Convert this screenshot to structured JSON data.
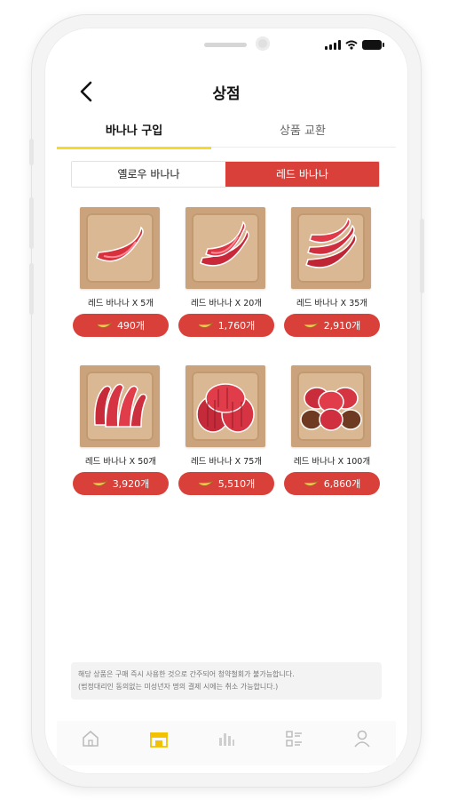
{
  "header": {
    "title": "상점"
  },
  "tabs": [
    {
      "label": "바나나 구입",
      "active": true
    },
    {
      "label": "상품 교환",
      "active": false
    }
  ],
  "segments": [
    {
      "label": "옐로우 바나나",
      "active": false
    },
    {
      "label": "레드 바나나",
      "active": true
    }
  ],
  "products": [
    {
      "name": "레드 바나나 X 5개",
      "price": "490개",
      "icon": "banana-single-icon"
    },
    {
      "name": "레드 바나나 X 20개",
      "price": "1,760개",
      "icon": "banana-double-icon"
    },
    {
      "name": "레드 바나나 X 35개",
      "price": "2,910개",
      "icon": "banana-triple-icon"
    },
    {
      "name": "레드 바나나 X 50개",
      "price": "3,920개",
      "icon": "banana-bunch-icon"
    },
    {
      "name": "레드 바나나 X 75개",
      "price": "5,510개",
      "icon": "banana-big-bunch-icon"
    },
    {
      "name": "레드 바나나 X 100개",
      "price": "6,860개",
      "icon": "banana-box-icon"
    }
  ],
  "notice": {
    "line1": "해당 상품은 구매 즉시 사용한 것으로 간주되어 청약철회가 불가능합니다.",
    "line2": "(법정대리인 동의없는 미성년자 명의 결제 시에는 취소 가능합니다.)"
  },
  "colors": {
    "accent_red": "#d9403a",
    "tab_underline": "#f6d92b",
    "nav_active": "#f2c200"
  }
}
